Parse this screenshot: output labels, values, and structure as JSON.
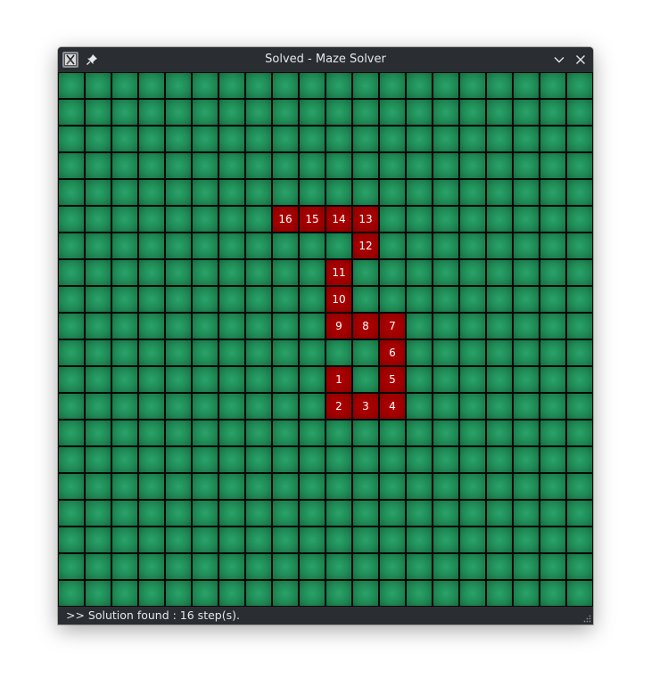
{
  "window": {
    "title": "Solved - Maze Solver"
  },
  "titlebar": {
    "app_icon": "x-app-icon",
    "pin_icon": "pin-icon",
    "minimize_icon": "chevron-down-icon",
    "close_icon": "close-icon"
  },
  "maze": {
    "rows": 20,
    "cols": 20,
    "open_color": "#1f8a55",
    "path_color": "#9e0000",
    "path": [
      {
        "step": "1",
        "row": 11,
        "col": 10
      },
      {
        "step": "2",
        "row": 12,
        "col": 10
      },
      {
        "step": "3",
        "row": 12,
        "col": 11
      },
      {
        "step": "4",
        "row": 12,
        "col": 12
      },
      {
        "step": "5",
        "row": 11,
        "col": 12
      },
      {
        "step": "6",
        "row": 10,
        "col": 12
      },
      {
        "step": "7",
        "row": 9,
        "col": 12
      },
      {
        "step": "8",
        "row": 9,
        "col": 11
      },
      {
        "step": "9",
        "row": 9,
        "col": 10
      },
      {
        "step": "10",
        "row": 8,
        "col": 10
      },
      {
        "step": "11",
        "row": 7,
        "col": 10
      },
      {
        "step": "12",
        "row": 6,
        "col": 11
      },
      {
        "step": "13",
        "row": 5,
        "col": 11
      },
      {
        "step": "14",
        "row": 5,
        "col": 10
      },
      {
        "step": "15",
        "row": 5,
        "col": 9
      },
      {
        "step": "16",
        "row": 5,
        "col": 8
      }
    ]
  },
  "status": {
    "text": ">> Solution found : 16 step(s)."
  }
}
